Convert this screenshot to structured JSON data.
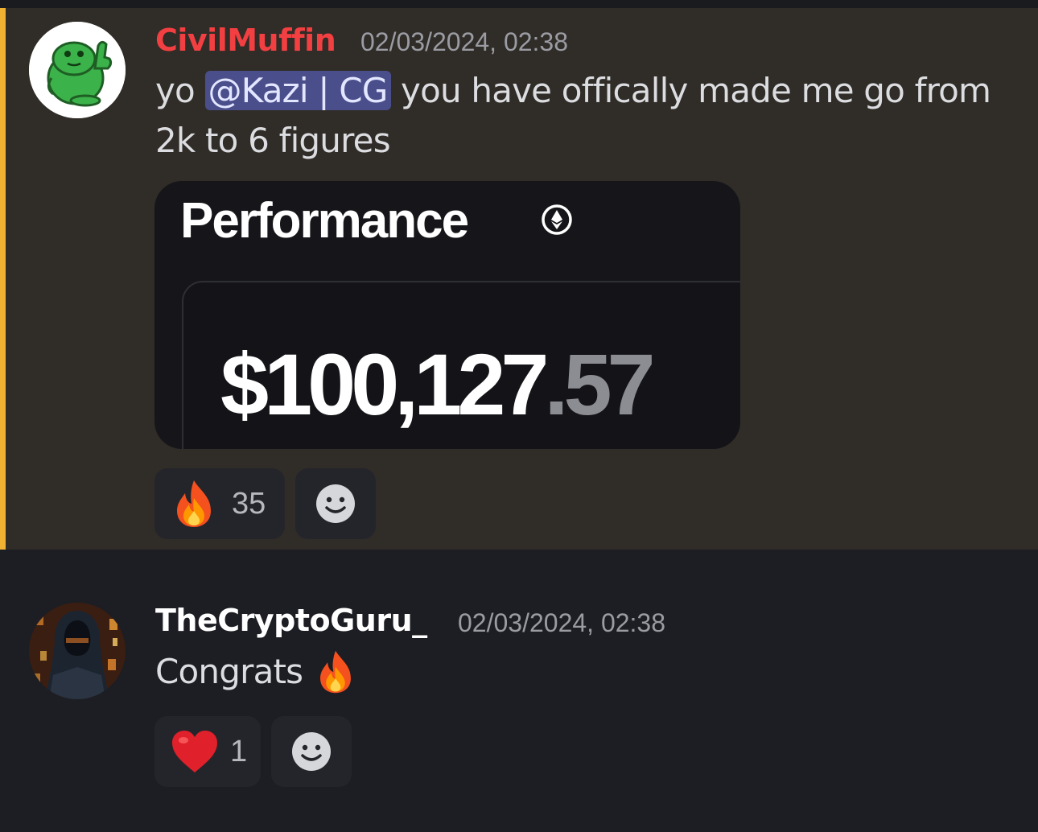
{
  "messages": [
    {
      "username": "CivilMuffin",
      "username_color": "#f23f42",
      "timestamp": "02/03/2024, 02:38",
      "text_before": "yo ",
      "mention": "@Kazi | CG",
      "text_after_line1": " you have offically made me go from",
      "text_line2": "2k to 6 figures",
      "avatar_icon": "frog-thumbs-up-avatar",
      "embed": {
        "title": "Performance",
        "icon": "ethereum-icon",
        "amount_main": "$100,127",
        "amount_cents": ".57"
      },
      "reactions": [
        {
          "emoji": "fire-emoji",
          "count": "35"
        }
      ]
    },
    {
      "username": "TheCryptoGuru_",
      "username_color": "#ffffff",
      "timestamp": "02/03/2024, 02:38",
      "text": "Congrats",
      "avatar_icon": "hooded-ninja-avatar",
      "reactions": [
        {
          "emoji": "heart-emoji",
          "count": "1"
        }
      ]
    }
  ],
  "colors": {
    "background": "#1d1e23",
    "highlight": "#302c27",
    "mention_bar": "#f0b232",
    "mention_bg": "#4a4f8c"
  }
}
